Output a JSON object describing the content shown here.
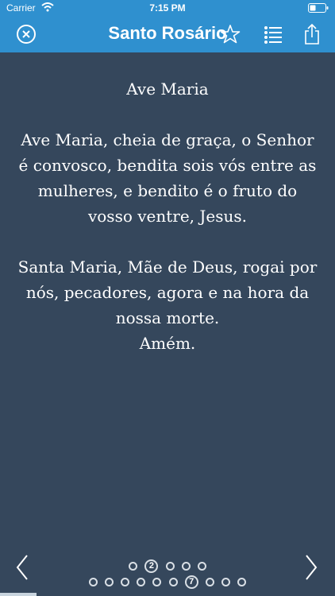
{
  "status_bar": {
    "carrier": "Carrier",
    "time": "7:15 PM"
  },
  "nav": {
    "title": "Santo Rosário",
    "icons": [
      "close-icon",
      "star-icon",
      "list-icon",
      "share-icon"
    ]
  },
  "prayer": {
    "title": "Ave Maria",
    "paragraph_1": "Ave Maria, cheia de graça, o Senhor\né convosco, bendita sois vós entre as\nmulheres, e bendito é o fruto do\nvosso ventre, Jesus.",
    "paragraph_2": "Santa Maria, Mãe de Deus, rogai por\nnós, pecadores, agora e na hora da\nnossa morte.\nAmém."
  },
  "pager": {
    "top_current": "2",
    "bottom_current": "7",
    "top_total": 5,
    "bottom_total": 10
  },
  "colors": {
    "nav_bg": "#2f90cf",
    "content_bg": "#35475c",
    "text": "#ffffff"
  }
}
